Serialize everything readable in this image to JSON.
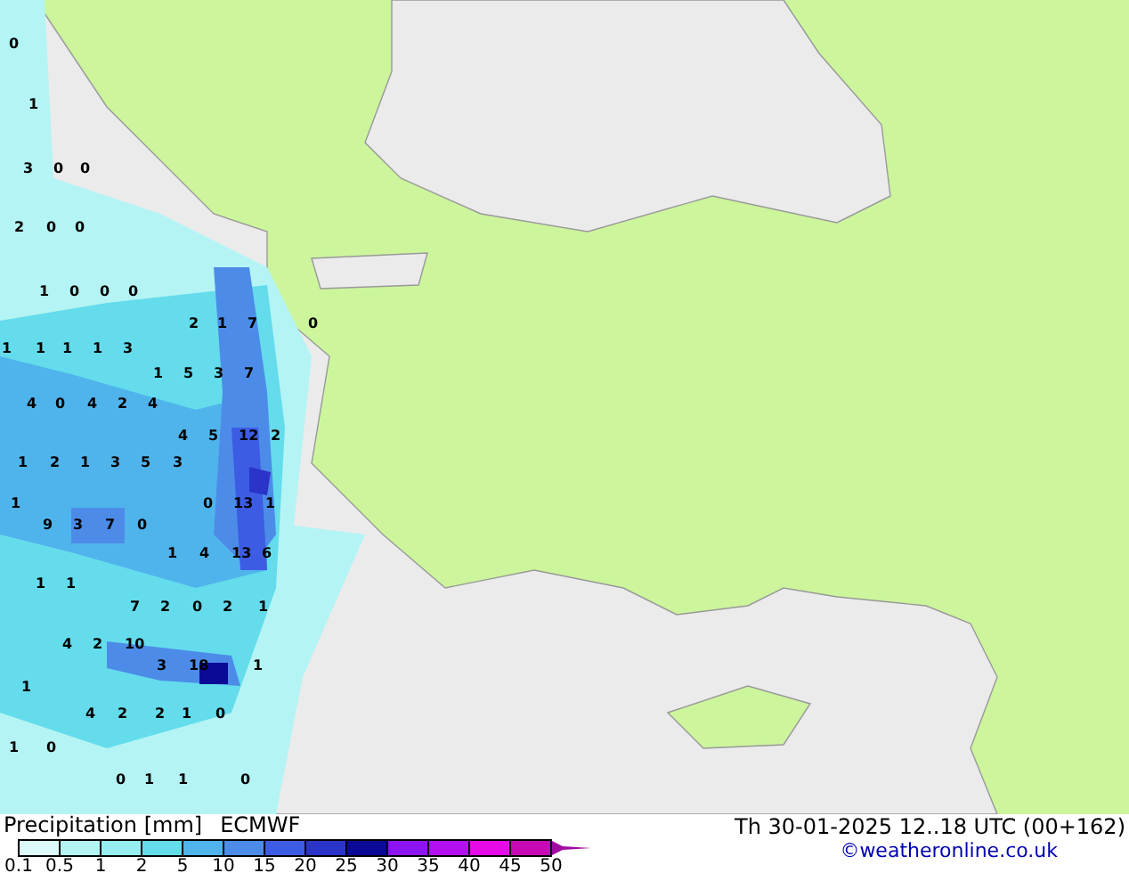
{
  "map": {
    "value_labels": [
      "0",
      "1",
      "3",
      "0",
      "0",
      "2",
      "0",
      "0",
      "1",
      "0",
      "0",
      "0",
      "2",
      "1",
      "7",
      "0",
      "1",
      "1",
      "1",
      "1",
      "3",
      "1",
      "5",
      "3",
      "7",
      "4",
      "0",
      "4",
      "2",
      "4",
      "4",
      "5",
      "12",
      "2",
      "1",
      "2",
      "1",
      "3",
      "5",
      "3",
      "1",
      "0",
      "13",
      "1",
      "9",
      "3",
      "7",
      "0",
      "1",
      "4",
      "13",
      "6",
      "1",
      "1",
      "7",
      "2",
      "0",
      "2",
      "1",
      "4",
      "2",
      "10",
      "3",
      "18",
      "1",
      "1",
      "4",
      "2",
      "2",
      "1",
      "0",
      "1",
      "0",
      "0",
      "1",
      "1",
      "0"
    ]
  },
  "footer": {
    "title": "Precipitation [mm]",
    "model": "ECMWF",
    "valid_time": "Th 30-01-2025 12..18 UTC (00+162)",
    "credit": "©weatheronline.co.uk"
  },
  "legend": {
    "bins": [
      {
        "color": "#dcfafa"
      },
      {
        "color": "#b4f4f4"
      },
      {
        "color": "#96eef0"
      },
      {
        "color": "#64dcec"
      },
      {
        "color": "#50b4ec"
      },
      {
        "color": "#4c8ce8"
      },
      {
        "color": "#3c5ce4"
      },
      {
        "color": "#2a34c8"
      },
      {
        "color": "#0a0a96"
      },
      {
        "color": "#8c14f0"
      },
      {
        "color": "#b40ff0"
      },
      {
        "color": "#e60ae6"
      },
      {
        "color": "#c80ab4"
      }
    ],
    "labels": [
      "0.1",
      "0.5",
      "1",
      "2",
      "5",
      "10",
      "15",
      "20",
      "25",
      "30",
      "35",
      "40",
      "45",
      "50"
    ]
  }
}
